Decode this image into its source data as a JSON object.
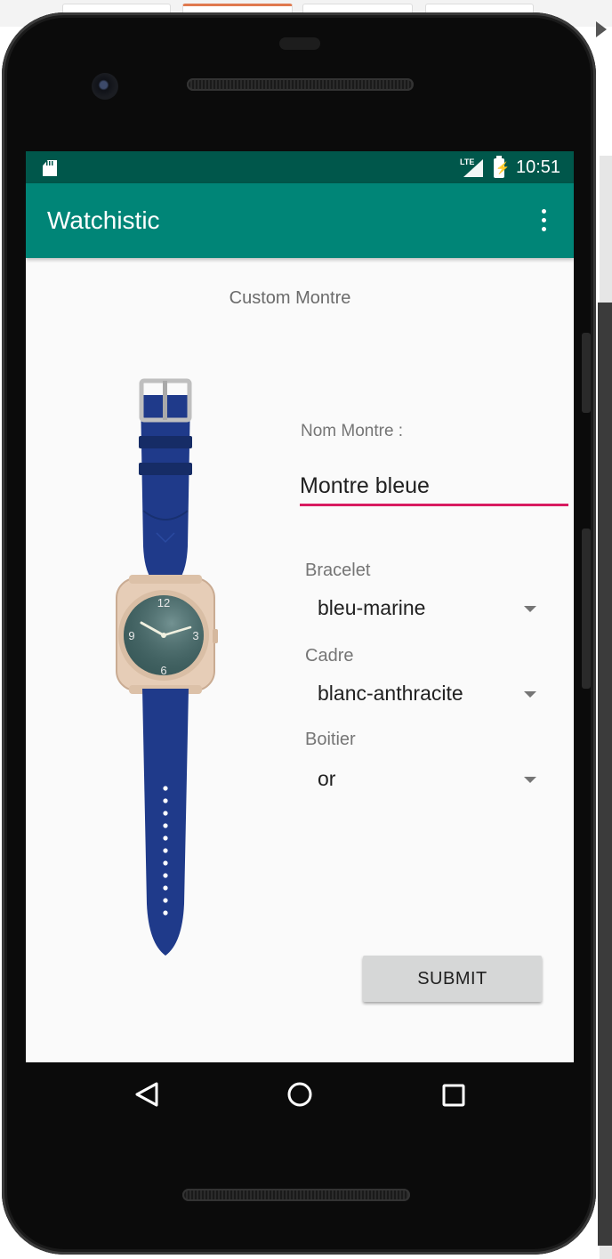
{
  "status_bar": {
    "network": "LTE",
    "time": "10:51"
  },
  "app_bar": {
    "title": "Watchistic"
  },
  "main": {
    "heading": "Custom Montre",
    "name_label": "Nom Montre :",
    "name_value": "Montre bleue",
    "fields": [
      {
        "label": "Bracelet",
        "value": "bleu-marine"
      },
      {
        "label": "Cadre",
        "value": "blanc-anthracite"
      },
      {
        "label": "Boitier",
        "value": "or"
      }
    ],
    "submit_label": "SUBMIT"
  },
  "colors": {
    "primary": "#008577",
    "primary_dark": "#00574b",
    "accent": "#d81b60",
    "strap": "#1f3a8a",
    "case": "#e6cdb7",
    "dial": "#3d5f5f"
  },
  "icons": [
    "sd-card-icon",
    "signal-icon",
    "battery-charging-icon",
    "overflow-menu-icon",
    "back-icon",
    "home-icon",
    "recents-icon"
  ]
}
